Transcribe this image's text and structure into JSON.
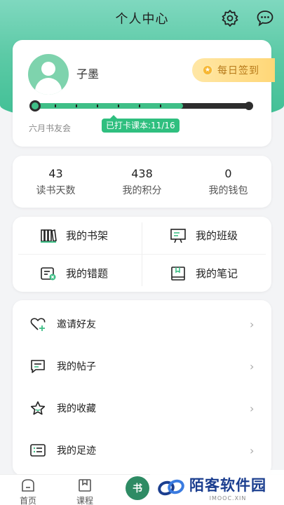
{
  "header": {
    "title": "个人中心",
    "settings_icon": "gear-icon",
    "messages_icon": "chat-bubble-icon"
  },
  "profile": {
    "username": "子墨",
    "checkin_label": "每日签到",
    "group_name": "六月书友会",
    "clock_in_status": "已打卡课本:11/16",
    "progress_fraction": 0.6875
  },
  "stats": [
    {
      "value": "43",
      "label": "读书天数"
    },
    {
      "value": "438",
      "label": "我的积分"
    },
    {
      "value": "0",
      "label": "我的钱包"
    }
  ],
  "grid": [
    {
      "label": "我的书架",
      "icon": "bookshelf-icon"
    },
    {
      "label": "我的班级",
      "icon": "classroom-icon"
    },
    {
      "label": "我的错题",
      "icon": "mistakes-icon"
    },
    {
      "label": "我的笔记",
      "icon": "notebook-icon"
    }
  ],
  "menu": [
    {
      "label": "邀请好友",
      "icon": "heart-plus-icon"
    },
    {
      "label": "我的帖子",
      "icon": "message-square-icon"
    },
    {
      "label": "我的收藏",
      "icon": "star-icon"
    },
    {
      "label": "我的足迹",
      "icon": "list-icon"
    }
  ],
  "tabbar": {
    "home": "首页",
    "courses": "课程",
    "center_glyph": "书"
  },
  "watermark": {
    "name": "陌客软件园",
    "sub": "IMOOC.XIN"
  },
  "colors": {
    "accent": "#3fbf87",
    "checkin_text": "#b77a1a",
    "watermark_blue": "#1b3e8f"
  }
}
